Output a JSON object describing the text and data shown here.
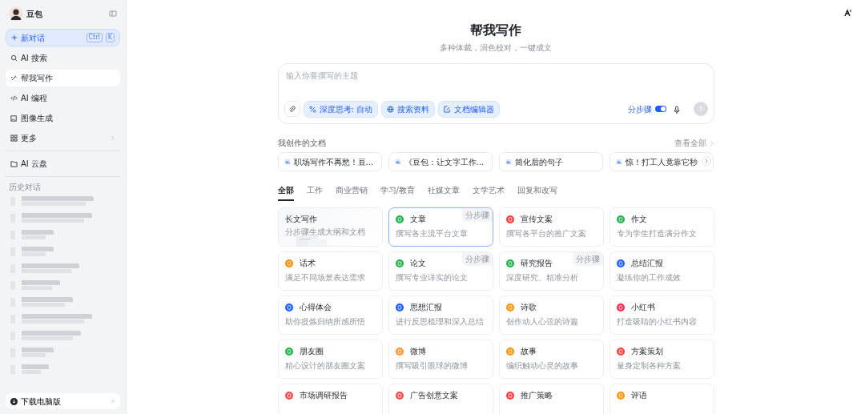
{
  "sidebar": {
    "app_name": "豆包",
    "new_chat": {
      "label": "新对话",
      "shortcut": [
        "Ctrl",
        "K"
      ]
    },
    "nav": [
      {
        "label": "AI 搜索",
        "selected": false,
        "chevron": false
      },
      {
        "label": "帮我写作",
        "selected": true,
        "chevron": false
      },
      {
        "label": "AI 编程",
        "selected": false,
        "chevron": false
      },
      {
        "label": "图像生成",
        "selected": false,
        "chevron": false
      },
      {
        "label": "更多",
        "selected": false,
        "chevron": true
      }
    ],
    "cloud": {
      "label": "AI 云盘"
    },
    "history_title": "历史对话",
    "download": {
      "label": "下载电脑版"
    }
  },
  "main": {
    "title": "帮我写作",
    "subtitle": "多种体裁，润色校对，一键成文",
    "composer": {
      "placeholder": "输入你要撰写的主题",
      "tools": [
        {
          "label": "深度思考: 自动"
        },
        {
          "label": "搜索资料"
        },
        {
          "label": "文档编辑器"
        }
      ],
      "step_toggle": {
        "label": "分步骤",
        "on": true
      }
    },
    "docs": {
      "title": "我创作的文档",
      "view_all": "查看全部",
      "items": [
        {
          "title": "职场写作不再愁！豆..."
        },
        {
          "title": "《豆包：让文字工作..."
        },
        {
          "title": "简化后的句子"
        },
        {
          "title": "惊！打工人竟靠它秒"
        }
      ]
    },
    "tabs": [
      {
        "label": "全部",
        "selected": true
      },
      {
        "label": "工作",
        "selected": false
      },
      {
        "label": "商业营销",
        "selected": false
      },
      {
        "label": "学习/教育",
        "selected": false
      },
      {
        "label": "社媒文章",
        "selected": false
      },
      {
        "label": "文学艺术",
        "selected": false
      },
      {
        "label": "回复和改写",
        "selected": false
      }
    ],
    "cards": [
      {
        "kind": "feature",
        "title": "长文写作",
        "desc": "分步骤生成大纲和文档",
        "selected": false
      },
      {
        "kind": "tool",
        "title": "文章",
        "desc": "撰写各主流平台文章",
        "color": "#22b14c",
        "badge": "分步骤",
        "selected": true
      },
      {
        "kind": "tool",
        "title": "宣传文案",
        "desc": "撰写各平台的推广文案",
        "color": "#f53f3f",
        "selected": false
      },
      {
        "kind": "tool",
        "title": "作文",
        "desc": "专为学生打造满分作文",
        "color": "#22b14c",
        "selected": false
      },
      {
        "kind": "tool",
        "title": "话术",
        "desc": "满足不同场景表达需求",
        "color": "#ff8c00",
        "selected": false
      },
      {
        "kind": "tool",
        "title": "论文",
        "desc": "撰写专业详实的论文",
        "color": "#22b14c",
        "badge": "分步骤",
        "selected": false
      },
      {
        "kind": "tool",
        "title": "研究报告",
        "desc": "深度研究、精准分析",
        "color": "#22b14c",
        "badge": "分步骤",
        "selected": false
      },
      {
        "kind": "tool",
        "title": "总结汇报",
        "desc": "凝练你的工作成效",
        "color": "#1d5cff",
        "selected": false
      },
      {
        "kind": "tool",
        "title": "心得体会",
        "desc": "助你提炼归纳所感所悟",
        "color": "#1d5cff",
        "selected": false
      },
      {
        "kind": "tool",
        "title": "思想汇报",
        "desc": "进行反思梳理和深入总结",
        "color": "#1d5cff",
        "selected": false
      },
      {
        "kind": "tool",
        "title": "诗歌",
        "desc": "创作动人心弦的诗篇",
        "color": "#ff9500",
        "selected": false
      },
      {
        "kind": "tool",
        "title": "小红书",
        "desc": "打造吸睛的小红书内容",
        "color": "#f5284b",
        "selected": false
      },
      {
        "kind": "tool",
        "title": "朋友圈",
        "desc": "精心设计的朋友圈文案",
        "color": "#22b14c",
        "selected": false
      },
      {
        "kind": "tool",
        "title": "微博",
        "desc": "撰写吸引眼球的微博",
        "color": "#ff9533",
        "selected": false
      },
      {
        "kind": "tool",
        "title": "故事",
        "desc": "编织触动心灵的故事",
        "color": "#ff9500",
        "selected": false
      },
      {
        "kind": "tool",
        "title": "方案策划",
        "desc": "量身定制各种方案",
        "color": "#f53f3f",
        "selected": false
      },
      {
        "kind": "tool",
        "title": "市场调研报告",
        "color": "#f04b4b",
        "selected": false
      },
      {
        "kind": "tool",
        "title": "广告创意文案",
        "color": "#f04b4b",
        "selected": false
      },
      {
        "kind": "tool",
        "title": "推广策略",
        "color": "#f53f3f",
        "selected": false
      },
      {
        "kind": "tool",
        "title": "评语",
        "color": "#ff9500",
        "selected": false
      }
    ]
  }
}
